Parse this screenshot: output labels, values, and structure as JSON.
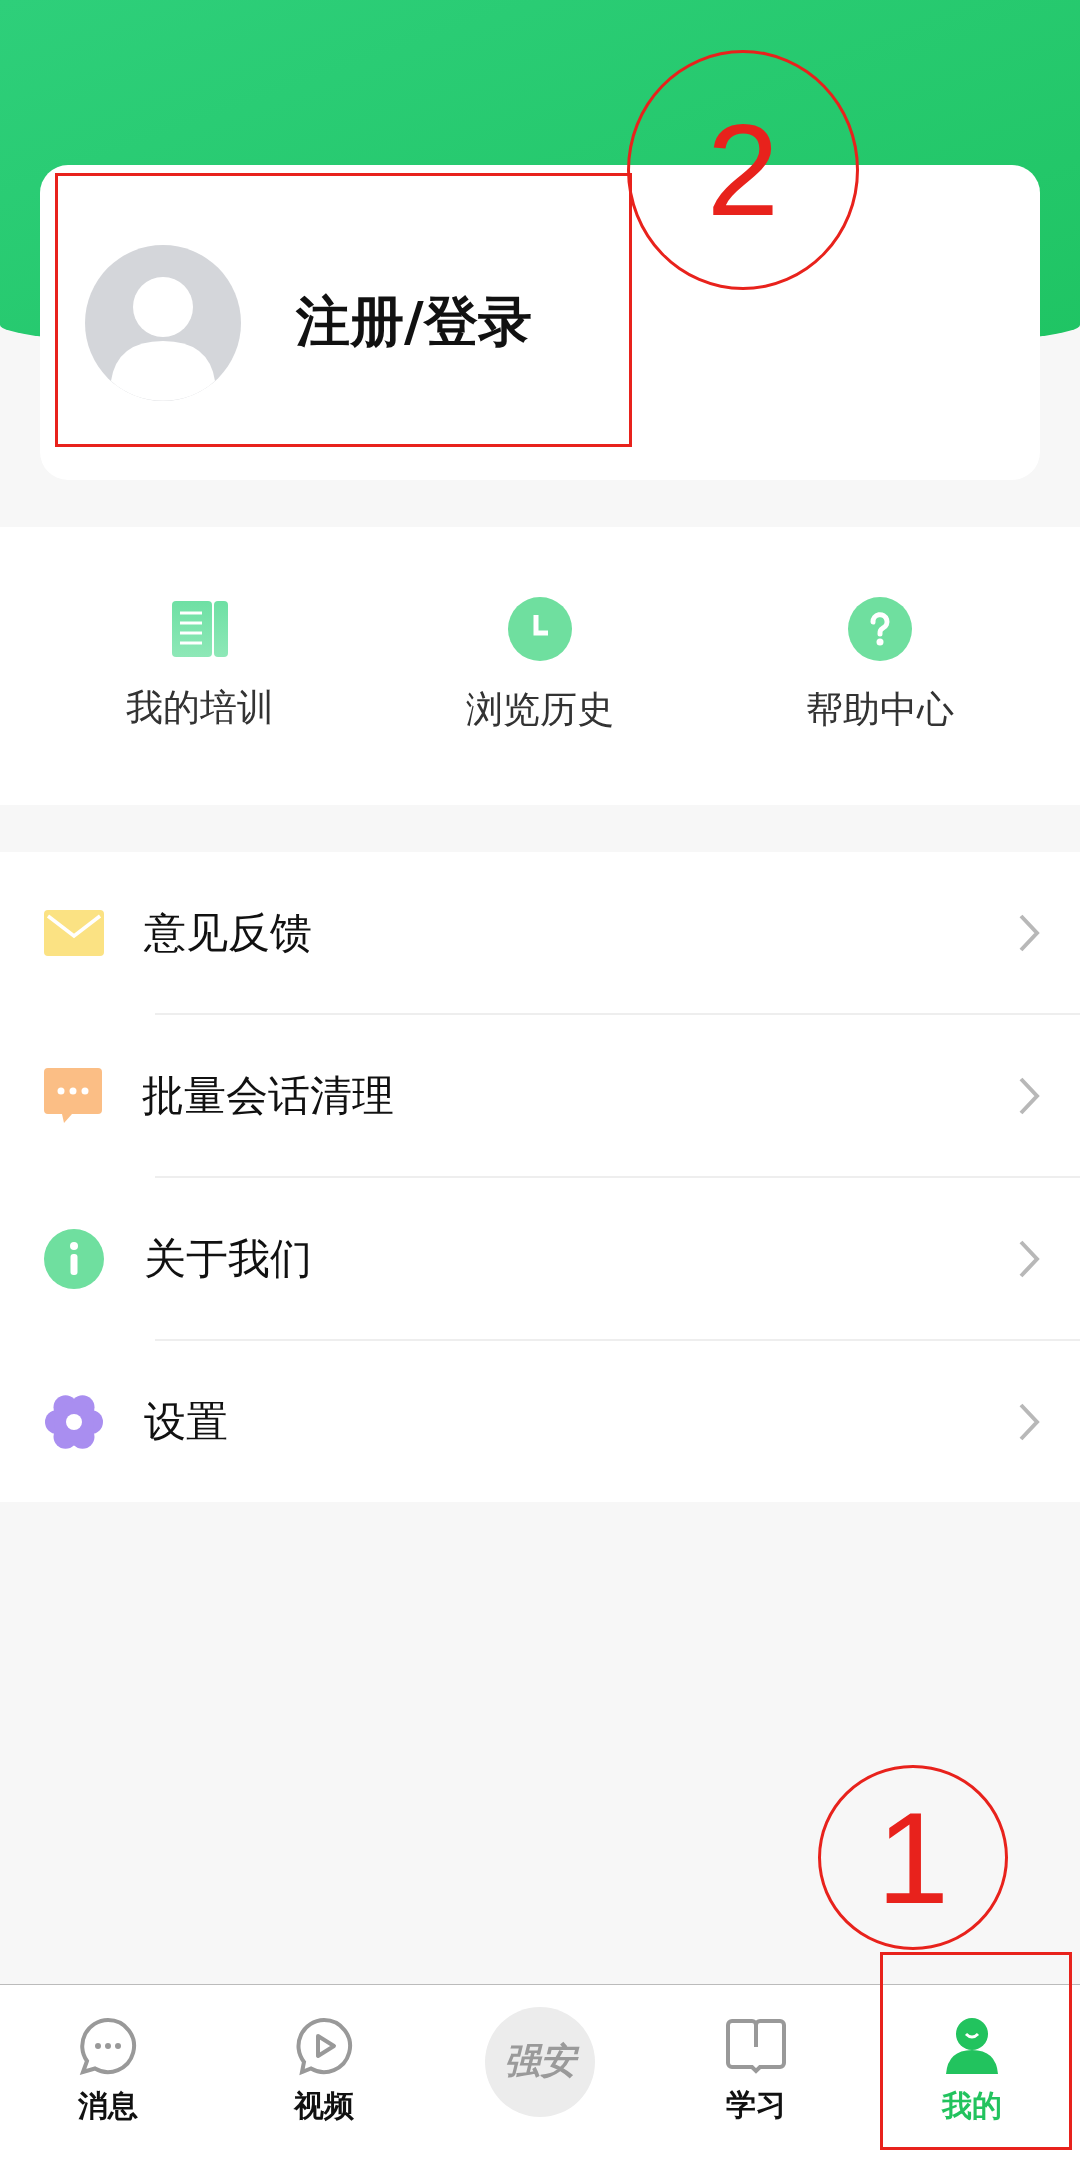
{
  "profile": {
    "login_label": "注册/登录"
  },
  "shortcuts": [
    {
      "kind": "book",
      "label": "我的培训"
    },
    {
      "kind": "clock",
      "label": "浏览历史"
    },
    {
      "kind": "help",
      "label": "帮助中心"
    }
  ],
  "menu": [
    {
      "kind": "mail",
      "label": "意见反馈"
    },
    {
      "kind": "chat",
      "label": "批量会话清理"
    },
    {
      "kind": "info",
      "label": "关于我们"
    },
    {
      "kind": "gear",
      "label": "设置"
    }
  ],
  "tab_bar": [
    {
      "kind": "message",
      "label": "消息",
      "selected": false
    },
    {
      "kind": "video",
      "label": "视频",
      "selected": false
    },
    {
      "kind": "logo",
      "label": "强安",
      "selected": false
    },
    {
      "kind": "study",
      "label": "学习",
      "selected": false
    },
    {
      "kind": "me",
      "label": "我的",
      "selected": true
    }
  ],
  "annotations": [
    {
      "kind": "rect"
    },
    {
      "kind": "circle",
      "label": "2"
    },
    {
      "kind": "circle",
      "label": "1"
    },
    {
      "kind": "rect"
    }
  ]
}
